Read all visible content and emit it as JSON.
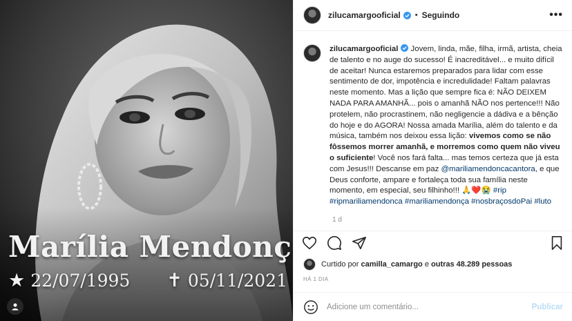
{
  "media": {
    "overlay_name": "Marília Mendonça",
    "birth_date": "22/07/1995",
    "death_date": "05/11/2021",
    "star_glyph": "★",
    "cross_glyph": "✝"
  },
  "header": {
    "username": "zilucamargooficial",
    "separator": "•",
    "follow_status": "Seguindo",
    "more_glyph": "•••"
  },
  "caption": {
    "username": "zilucamargooficial",
    "part1": " Jovem, linda, mãe, filha, irmã, artista, cheia de talento e no auge do sucesso! É inacreditável... e muito difícil de aceitar! Nunca estaremos preparados para lidar com esse sentimento de dor, impotência e incredulidade! Faltam palavras neste momento. Mas a lição que sempre fica é: NÃO DEIXEM NADA PARA AMANHÃ... pois o amanhã NÃO nos pertence!!! Não protelem, não procrastinem, não negligencie a dádiva e a bênção do hoje e do AGORA! Nossa amada Marília, além do talento e da música, também nos deixou essa lição: ",
    "bold": "vivemos como se não fôssemos morrer amanhã, e morremos como quem não viveu o suficiente",
    "part2": "! Você nos fará falta... mas temos certeza que já esta com Jesus!!! Descanse em paz ",
    "mention": "@mariliamendoncacantora",
    "part3": ", e que Deus conforte, ampare e fortaleça toda sua família neste momento, em especial, seu filhinho!!! 🙏❤️😭 ",
    "hashtags1": "#rip #ripmariliamendonca",
    "hashtags2": "#mariliamendonça #nosbraçosdoPai #luto",
    "age": "1 d"
  },
  "likes": {
    "prefix": "Curtido por ",
    "user": "camilla_camargo",
    "middle": " e ",
    "count": "outras 48.289 pessoas"
  },
  "timestamp": "HÁ 1 DIA",
  "comment": {
    "placeholder": "Adicione um comentário...",
    "publish_label": "Publicar"
  },
  "colors": {
    "link": "#00376b",
    "verified": "#3897f0",
    "muted": "#8e8e8e",
    "publish_disabled": "#b9dcf7"
  },
  "icons": [
    "heart-icon",
    "comment-icon",
    "share-icon",
    "bookmark-icon",
    "emoji-icon",
    "verified-icon",
    "user-tag-icon",
    "more-options-icon"
  ]
}
